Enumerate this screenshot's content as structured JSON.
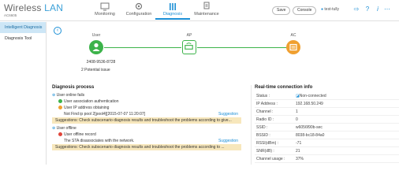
{
  "header": {
    "brand": "Wireless",
    "brand_accent": "LAN",
    "model": "AC6605",
    "nav": [
      {
        "label": "Monitoring",
        "icon": "monitor-icon",
        "active": false
      },
      {
        "label": "Configuration",
        "icon": "gear-icon",
        "active": false
      },
      {
        "label": "Diagnosis",
        "icon": "bars-icon",
        "active": true
      },
      {
        "label": "Maintenance",
        "icon": "wrench-icon",
        "active": false
      }
    ],
    "save_label": "Save",
    "console_label": "Console",
    "user_label": "test-tully",
    "colors": {
      "accent": "#1c8fd6",
      "ok": "#3cb34a",
      "warn": "#f0a030",
      "error": "#e0453a"
    }
  },
  "sidebar": {
    "items": [
      {
        "label": "Intelligent Diagnosis",
        "active": true
      },
      {
        "label": "Diagnosis Tool",
        "active": false
      }
    ]
  },
  "topology": {
    "user_label": "User",
    "ap_label": "AP",
    "ac_label": "AC",
    "mac": "2408-9536-8728",
    "issue_count": "2",
    "issue_text": "Potential issue"
  },
  "diagnosis": {
    "title": "Diagnosis process",
    "groups": [
      {
        "title": "User online fails",
        "steps": [
          {
            "text": "User association authentication",
            "status": "ok"
          },
          {
            "text": "User IP address obtaining",
            "status": "warn"
          },
          {
            "text": "Not Find ip pool 2[pool4][2015-07-07 11:20:07]",
            "status": "none",
            "link": "Suggestion"
          }
        ],
        "suggestion": "Suggestions: Check subscenario diagnosis results and troubleshoot the problems according to give..."
      },
      {
        "title": "User offline",
        "steps": [
          {
            "text": "User offline record",
            "status": "error"
          },
          {
            "text": "The STA disassociates with the network.",
            "status": "none",
            "link": "Suggestion"
          }
        ],
        "suggestion": "Suggestions: Check subscenario diagnosis results and troubleshoot the problems according to ..."
      }
    ]
  },
  "rt_info": {
    "title": "Real-time connection info",
    "rows": [
      {
        "k": "Status :",
        "v": "Non-connected"
      },
      {
        "k": "IP Address :",
        "v": "192.168.50.249"
      },
      {
        "k": "Channel :",
        "v": "1"
      },
      {
        "k": "Radio ID :",
        "v": "0"
      },
      {
        "k": "SSID :",
        "v": "w6056f90b-sec"
      },
      {
        "k": "BSSID :",
        "v": "8038-bc18-84a0"
      },
      {
        "k": "RSSI(dBm) :",
        "v": "-71"
      },
      {
        "k": "SNR(dB) :",
        "v": "21"
      },
      {
        "k": "Channel usage :",
        "v": "37%"
      }
    ]
  }
}
